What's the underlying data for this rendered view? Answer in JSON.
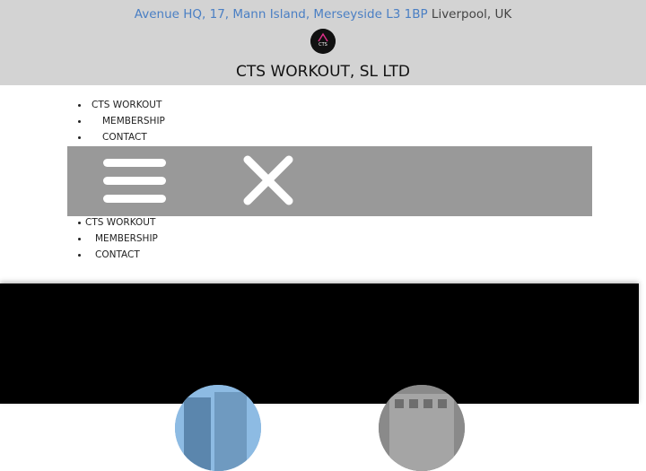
{
  "header": {
    "address_link": "Avenue HQ, 17, Mann Island, Merseyside L3 1BP",
    "address_city": "Liverpool, UK",
    "logo_text": "CTS",
    "title": "CTS WORKOUT, SL LTD"
  },
  "nav_top": {
    "items": [
      {
        "label": "CTS WORKOUT"
      },
      {
        "label": "MEMBERSHIP"
      },
      {
        "label": "CONTACT"
      }
    ]
  },
  "nav_bottom": {
    "items": [
      {
        "label": "CTS WORKOUT"
      },
      {
        "label": "MEMBERSHIP"
      },
      {
        "label": "CONTACT"
      }
    ]
  },
  "menu_bar": {
    "icons": [
      "hamburger-menu-icon",
      "close-icon"
    ]
  },
  "colors": {
    "header_bg": "#d3d3d3",
    "link": "#4a7fc4",
    "menu_bar_bg": "#999999",
    "section_bg": "#000000"
  }
}
